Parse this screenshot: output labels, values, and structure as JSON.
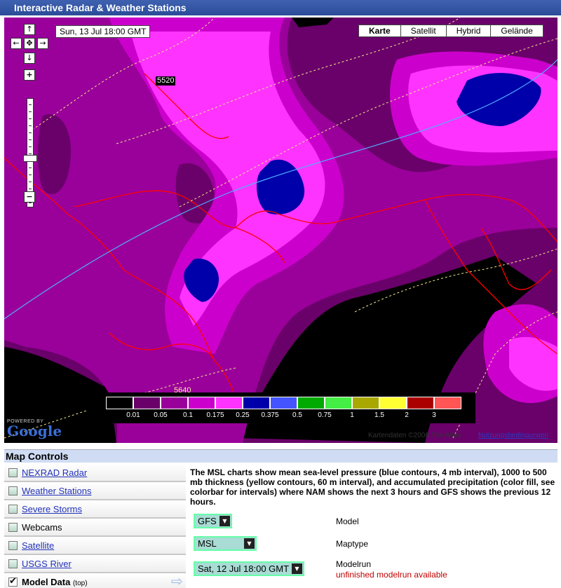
{
  "window": {
    "title": "Interactive Radar & Weather Stations"
  },
  "map": {
    "datetime": "Sun, 13 Jul 18:00 GMT",
    "map_types": [
      "Karte",
      "Satellit",
      "Hybrid",
      "Gelände"
    ],
    "active_map_type": "Karte",
    "contour_labels": [
      "5520",
      "5640"
    ],
    "zoom_level_fraction": 0.55,
    "copyright": "Kartendaten ©2008 Tele Atlas",
    "terms_link": "Nutzungsbedingungen",
    "powered_by": "POWERED BY",
    "logo_text": "Google"
  },
  "colorbar": {
    "colors": [
      "#000000",
      "#6a006a",
      "#9a009a",
      "#cc00cc",
      "#ff33ff",
      "#0000aa",
      "#4455ff",
      "#00aa00",
      "#44ee44",
      "#a8a800",
      "#ffff33",
      "#aa0000",
      "#ff5555"
    ],
    "labels": [
      "0.01",
      "0.05",
      "0.1",
      "0.175",
      "0.25",
      "0.375",
      "0.5",
      "0.75",
      "1",
      "1.5",
      "2",
      "3"
    ]
  },
  "controls": {
    "header": "Map Controls",
    "layers": [
      {
        "label": "NEXRAD Radar",
        "checked": false,
        "link": true
      },
      {
        "label": "Weather Stations",
        "checked": false,
        "link": true
      },
      {
        "label": "Severe Storms",
        "checked": false,
        "link": true
      },
      {
        "label": "Webcams",
        "checked": false,
        "link": false
      },
      {
        "label": "Satellite",
        "checked": false,
        "link": true
      },
      {
        "label": "USGS River",
        "checked": false,
        "link": true
      },
      {
        "label": "Model Data",
        "suffix": "(top)",
        "checked": true,
        "link": false
      }
    ],
    "description": "The MSL charts show mean sea-level pressure (blue contours, 4 mb interval), 1000 to 500 mb thickness (yellow contours, 60 m interval), and accumulated precipitation (color fill, see colorbar for intervals) where NAM shows the next 3 hours and GFS shows the previous 12 hours.",
    "model": {
      "value": "GFS",
      "label": "Model"
    },
    "maptype": {
      "value": "MSL",
      "label": "Maptype"
    },
    "modelrun": {
      "value": "Sat, 12 Jul 18:00 GMT",
      "label": "Modelrun"
    },
    "warning": "unfinished modelrun available"
  },
  "icons": {
    "pan_up": "↑",
    "pan_down": "↓",
    "pan_left": "←",
    "pan_right": "→",
    "pan_center": "✥",
    "zoom_in": "+",
    "zoom_out": "−",
    "dropdown": "▼",
    "next": "⇨"
  }
}
